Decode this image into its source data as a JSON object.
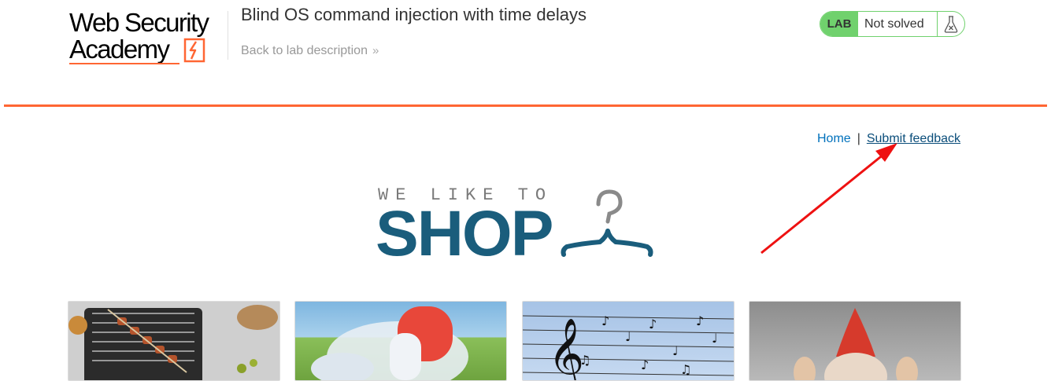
{
  "logo": {
    "line1": "Web Security",
    "line2": "Academy",
    "accent_color": "#ff6633"
  },
  "lab": {
    "title": "Blind OS command injection with time delays",
    "back_link": "Back to lab description",
    "back_icon": "double-chevron-right-icon"
  },
  "status": {
    "badge": "LAB",
    "text": "Not solved",
    "badge_color": "#70d16d",
    "icon": "flask-icon"
  },
  "nav": {
    "home": "Home",
    "separator": "|",
    "feedback": "Submit feedback",
    "link_color": "#0071bc"
  },
  "banner": {
    "tagline": "WE LIKE TO",
    "word": "SHOP",
    "icon": "hanger-icon",
    "word_color": "#1a5d7c"
  },
  "products": [
    {
      "image": "barbecue-grill-image"
    },
    {
      "image": "inflatable-image"
    },
    {
      "image": "birds-on-wires-music-image"
    },
    {
      "image": "gnome-image"
    }
  ],
  "annotation": {
    "type": "arrow",
    "color": "#ee1111"
  }
}
